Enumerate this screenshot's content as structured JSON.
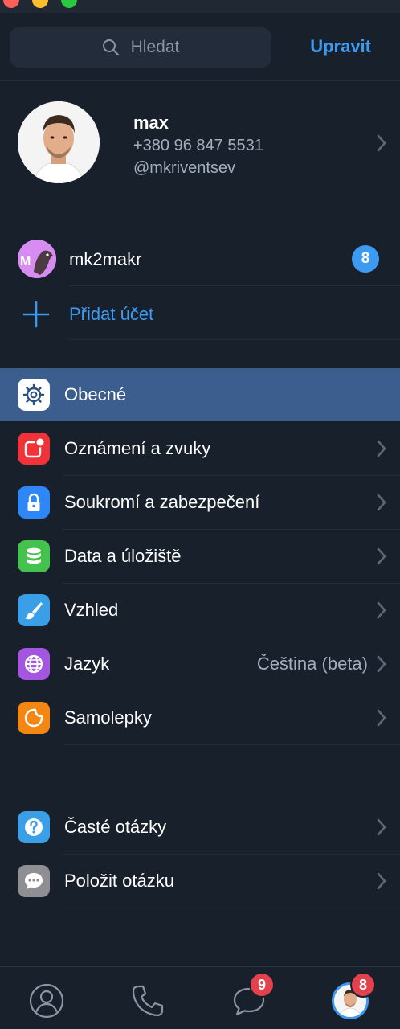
{
  "search": {
    "placeholder": "Hledat"
  },
  "header": {
    "edit_label": "Upravit"
  },
  "profile": {
    "name": "max",
    "phone": "+380 96 847 5531",
    "username": "@mkriventsev"
  },
  "accounts": [
    {
      "name": "mk2makr",
      "badge": "8",
      "avatar_letter": "M"
    }
  ],
  "add_account": {
    "label": "Přidat účet"
  },
  "settings": {
    "items": [
      {
        "label": "Obecné",
        "icon": "gear-icon",
        "color": "#ffffff",
        "selected": true
      },
      {
        "label": "Oznámení a zvuky",
        "icon": "notification-icon",
        "color": "#ef3339"
      },
      {
        "label": "Soukromí a zabezpečení",
        "icon": "lock-icon",
        "color": "#2f86f5"
      },
      {
        "label": "Data a úložiště",
        "icon": "database-icon",
        "color": "#44c24d"
      },
      {
        "label": "Vzhled",
        "icon": "brush-icon",
        "color": "#3b9fe8"
      },
      {
        "label": "Jazyk",
        "value": "Čeština (beta)",
        "icon": "globe-icon",
        "color": "#a556e0"
      },
      {
        "label": "Samolepky",
        "icon": "sticker-icon",
        "color": "#f48712"
      }
    ]
  },
  "help": {
    "items": [
      {
        "label": "Časté otázky",
        "icon": "question-icon",
        "color": "#3b9fe8"
      },
      {
        "label": "Položit otázku",
        "icon": "chat-bubble-icon",
        "color": "#8e8e93"
      }
    ]
  },
  "tabbar": {
    "tabs": [
      {
        "name": "contacts",
        "icon": "contacts-icon"
      },
      {
        "name": "calls",
        "icon": "phone-icon"
      },
      {
        "name": "chats",
        "icon": "chats-icon",
        "badge": "9"
      },
      {
        "name": "settings",
        "icon": "avatar",
        "badge": "8"
      }
    ]
  },
  "colors": {
    "accent": "#3c9bf0",
    "background": "#18202c",
    "selected_row": "#3b5e8f",
    "badge_red": "#e3424d"
  }
}
